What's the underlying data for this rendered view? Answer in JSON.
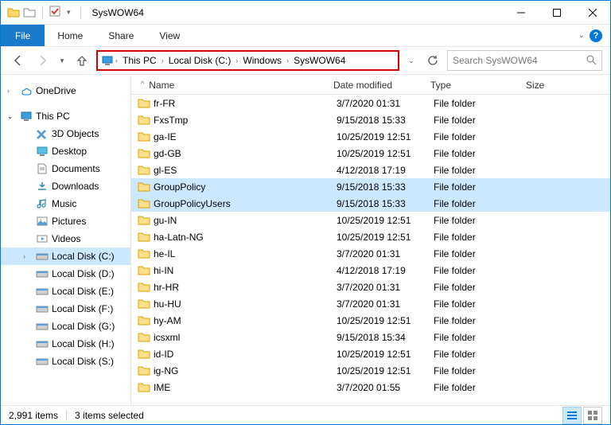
{
  "window": {
    "title": "SysWOW64"
  },
  "menubar": {
    "file": "File",
    "home": "Home",
    "share": "Share",
    "view": "View"
  },
  "breadcrumb": [
    {
      "label": "This PC"
    },
    {
      "label": "Local Disk (C:)"
    },
    {
      "label": "Windows"
    },
    {
      "label": "SysWOW64"
    }
  ],
  "search": {
    "placeholder": "Search SysWOW64"
  },
  "sidebar": {
    "onedrive": "OneDrive",
    "thispc": "This PC",
    "items": [
      "3D Objects",
      "Desktop",
      "Documents",
      "Downloads",
      "Music",
      "Pictures",
      "Videos",
      "Local Disk (C:)",
      "Local Disk (D:)",
      "Local Disk (E:)",
      "Local Disk (F:)",
      "Local Disk (G:)",
      "Local Disk (H:)",
      "Local Disk (S:)"
    ],
    "selected_index": 7
  },
  "columns": {
    "name": "Name",
    "date": "Date modified",
    "type": "Type",
    "size": "Size"
  },
  "rows": [
    {
      "name": "fr-FR",
      "date": "3/7/2020 01:31",
      "type": "File folder",
      "selected": false
    },
    {
      "name": "FxsTmp",
      "date": "9/15/2018 15:33",
      "type": "File folder",
      "selected": false
    },
    {
      "name": "ga-IE",
      "date": "10/25/2019 12:51",
      "type": "File folder",
      "selected": false
    },
    {
      "name": "gd-GB",
      "date": "10/25/2019 12:51",
      "type": "File folder",
      "selected": false
    },
    {
      "name": "gl-ES",
      "date": "4/12/2018 17:19",
      "type": "File folder",
      "selected": false
    },
    {
      "name": "GroupPolicy",
      "date": "9/15/2018 15:33",
      "type": "File folder",
      "selected": true
    },
    {
      "name": "GroupPolicyUsers",
      "date": "9/15/2018 15:33",
      "type": "File folder",
      "selected": true
    },
    {
      "name": "gu-IN",
      "date": "10/25/2019 12:51",
      "type": "File folder",
      "selected": false
    },
    {
      "name": "ha-Latn-NG",
      "date": "10/25/2019 12:51",
      "type": "File folder",
      "selected": false
    },
    {
      "name": "he-IL",
      "date": "3/7/2020 01:31",
      "type": "File folder",
      "selected": false
    },
    {
      "name": "hi-IN",
      "date": "4/12/2018 17:19",
      "type": "File folder",
      "selected": false
    },
    {
      "name": "hr-HR",
      "date": "3/7/2020 01:31",
      "type": "File folder",
      "selected": false
    },
    {
      "name": "hu-HU",
      "date": "3/7/2020 01:31",
      "type": "File folder",
      "selected": false
    },
    {
      "name": "hy-AM",
      "date": "10/25/2019 12:51",
      "type": "File folder",
      "selected": false
    },
    {
      "name": "icsxml",
      "date": "9/15/2018 15:34",
      "type": "File folder",
      "selected": false
    },
    {
      "name": "id-ID",
      "date": "10/25/2019 12:51",
      "type": "File folder",
      "selected": false
    },
    {
      "name": "ig-NG",
      "date": "10/25/2019 12:51",
      "type": "File folder",
      "selected": false
    },
    {
      "name": "IME",
      "date": "3/7/2020 01:55",
      "type": "File folder",
      "selected": false
    }
  ],
  "status": {
    "count": "2,991 items",
    "selection": "3 items selected"
  }
}
